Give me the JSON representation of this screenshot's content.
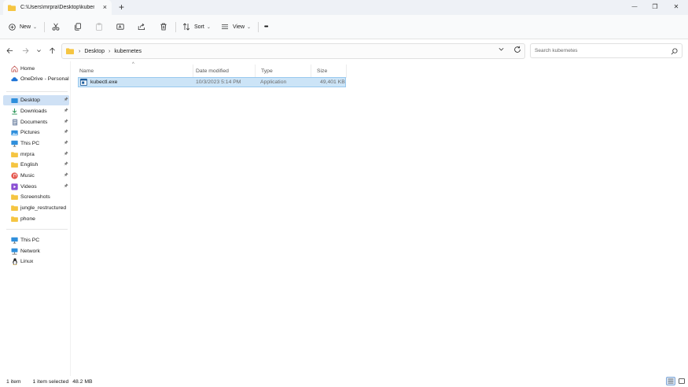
{
  "window": {
    "tab_title": "C:\\Users\\mrpra\\Desktop\\kubernetes",
    "tab_close": "×",
    "new_tab": "+",
    "minimize": "—",
    "maximize": "❐",
    "close": "✕"
  },
  "toolbar": {
    "new_label": "New",
    "sort_label": "Sort",
    "view_label": "View",
    "more_label": "•••",
    "icons": [
      "new-icon",
      "cut-icon",
      "copy-icon",
      "paste-icon",
      "rename-icon",
      "share-icon",
      "delete-icon",
      "sort-icon",
      "view-icon"
    ]
  },
  "address": {
    "breadcrumbs": [
      "Desktop",
      "kubernetes"
    ],
    "separator": "›",
    "search_placeholder": "Search kubernetes"
  },
  "sidebar": {
    "top_items": [
      {
        "label": "Home",
        "icon": "home-icon"
      },
      {
        "label": "OneDrive - Personal",
        "icon": "cloud-icon"
      }
    ],
    "quick_access": [
      {
        "label": "Desktop",
        "icon": "desktop-icon",
        "pinned": true,
        "selected": true
      },
      {
        "label": "Downloads",
        "icon": "download-icon",
        "pinned": true
      },
      {
        "label": "Documents",
        "icon": "document-icon",
        "pinned": true
      },
      {
        "label": "Pictures",
        "icon": "pictures-icon",
        "pinned": true
      },
      {
        "label": "This PC",
        "icon": "pc-icon",
        "pinned": true
      },
      {
        "label": "mrpra",
        "icon": "folder-icon",
        "pinned": true
      },
      {
        "label": "English",
        "icon": "folder-icon",
        "pinned": true
      },
      {
        "label": "Music",
        "icon": "music-icon",
        "pinned": true
      },
      {
        "label": "Videos",
        "icon": "videos-icon",
        "pinned": true
      },
      {
        "label": "Screenshots",
        "icon": "folder-icon",
        "pinned": false
      },
      {
        "label": "jungle_restructured",
        "icon": "folder-icon",
        "pinned": false
      },
      {
        "label": "phone",
        "icon": "folder-icon",
        "pinned": false
      }
    ],
    "bottom_items": [
      {
        "label": "This PC",
        "icon": "pc-icon"
      },
      {
        "label": "Network",
        "icon": "network-icon"
      },
      {
        "label": "Linux",
        "icon": "linux-icon"
      }
    ],
    "pin_glyph": "📌"
  },
  "file_list": {
    "columns": [
      "Name",
      "Date modified",
      "Type",
      "Size"
    ],
    "sort_indicator": "^",
    "rows": [
      {
        "name": "kubectl.exe",
        "date": "10/3/2023 5:14 PM",
        "type": "Application",
        "size": "49,401 KB",
        "selected": true
      }
    ]
  },
  "status": {
    "item_count": "1 item",
    "selected": "1 item selected",
    "selected_size": "48.2 MB"
  },
  "colors": {
    "accent": "#0067c0",
    "selection_bg": "#cce4f7",
    "selection_border": "#99c9ef",
    "folder": "#f5c542",
    "sidebar_selected": "#cfe1f5"
  }
}
